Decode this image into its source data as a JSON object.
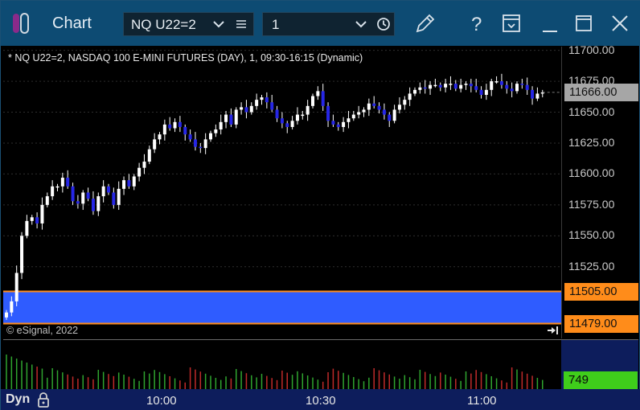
{
  "window": {
    "title": "Chart",
    "symbol": "NQ U22=2",
    "interval": "1",
    "icons": [
      "app-logo-icon",
      "chevron-down-icon",
      "list-menu-icon",
      "chevron-down-icon",
      "clock-icon",
      "pencil-icon",
      "help-icon",
      "save-template-icon",
      "minimize-icon",
      "maximize-icon",
      "close-icon"
    ]
  },
  "chart": {
    "description": "* NQ U22=2, NASDAQ 100 E-MINI FUTURES (DAY), 1, 09:30-16:15 (Dynamic)",
    "copyright": "© eSignal, 2022",
    "price_tags": {
      "last": "11666.00",
      "high": "11505.00",
      "low": "11479.00"
    },
    "volume_tag": "749",
    "dyn_label": "Dyn",
    "time_labels": [
      "10:00",
      "10:30",
      "11:00"
    ],
    "colors": {
      "up": "#ffffff",
      "down": "#2626e6",
      "band": "#2f5cff",
      "band_edge": "#ff8c1a",
      "vol_up": "#2fa52f",
      "vol_down": "#c02a2a",
      "title_bar": "#0d4b73",
      "axis_bg": "#0d1d5c"
    }
  },
  "chart_data": {
    "type": "candlestick",
    "price_axis": {
      "ticks": [
        11700,
        11675,
        11650,
        11625,
        11600,
        11575,
        11550,
        11525,
        11500
      ],
      "ylim": [
        11467,
        11703
      ]
    },
    "highlight_band": {
      "from": 11479.0,
      "to": 11505.0
    },
    "last_price": 11666.0,
    "volume_last": 749,
    "close_series": [
      11488,
      11497,
      11520,
      11550,
      11562,
      11565,
      11560,
      11575,
      11582,
      11590,
      11590,
      11597,
      11590,
      11578,
      11576,
      11585,
      11580,
      11570,
      11582,
      11590,
      11585,
      11575,
      11588,
      11595,
      11590,
      11598,
      11605,
      11610,
      11620,
      11628,
      11632,
      11640,
      11637,
      11642,
      11638,
      11632,
      11628,
      11622,
      11621,
      11628,
      11633,
      11636,
      11642,
      11648,
      11640,
      11652,
      11654,
      11650,
      11655,
      11660,
      11662,
      11658,
      11652,
      11645,
      11641,
      11638,
      11643,
      11648,
      11648,
      11655,
      11663,
      11667,
      11655,
      11643,
      11640,
      11638,
      11642,
      11645,
      11648,
      11650,
      11652,
      11657,
      11655,
      11652,
      11648,
      11643,
      11652,
      11656,
      11660,
      11665,
      11668,
      11670,
      11669,
      11672,
      11672,
      11670,
      11673,
      11673,
      11669,
      11672,
      11673,
      11671,
      11668,
      11664,
      11668,
      11675,
      11675,
      11672,
      11669,
      11667,
      11673,
      11672,
      11668,
      11661,
      11665,
      11666
    ]
  }
}
